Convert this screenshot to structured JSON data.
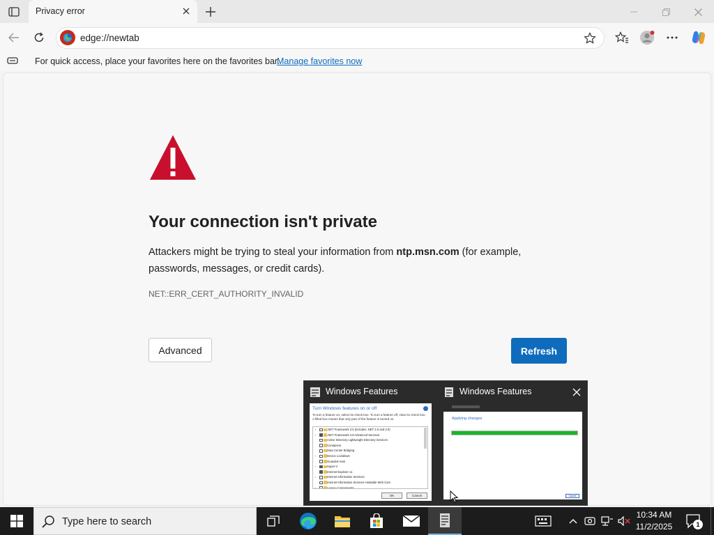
{
  "browser": {
    "tab": {
      "title": "Privacy error"
    },
    "address_bar": {
      "url": "edge://newtab"
    },
    "favorites_bar": {
      "message": "For quick access, place your favorites here on the favorites bar.",
      "link": "Manage favorites now"
    }
  },
  "error_page": {
    "title": "Your connection isn't private",
    "body_prefix": "Attackers might be trying to steal your information from ",
    "host": "ntp.msn.com",
    "body_suffix": " (for example, passwords, messages, or credit cards).",
    "error_code": "NET::ERR_CERT_AUTHORITY_INVALID",
    "advanced_label": "Advanced",
    "refresh_label": "Refresh"
  },
  "taskbar_preview": {
    "window1_title": "Windows Features",
    "window2_title": "Windows Features",
    "thumb1": {
      "heading": "Turn Windows features on or off",
      "description": "To turn a feature on, select its check box. To turn a feature off, clear its check box. A filled box means that only part of the feature is turned on.",
      "items": [
        {
          "label": ".NET Framework 3.5 (includes .NET 2.0 and 3.0)",
          "expandable": true,
          "checked": false
        },
        {
          "label": ".NET Framework 4.8 Advanced Services",
          "expandable": true,
          "checked": true
        },
        {
          "label": "Active Directory Lightweight Directory Services",
          "expandable": false,
          "checked": false
        },
        {
          "label": "Containers",
          "expandable": false,
          "checked": false
        },
        {
          "label": "Data Center Bridging",
          "expandable": false,
          "checked": false
        },
        {
          "label": "Device Lockdown",
          "expandable": true,
          "checked": false
        },
        {
          "label": "Guarded Host",
          "expandable": false,
          "checked": false
        },
        {
          "label": "Hyper-V",
          "expandable": true,
          "checked": true
        },
        {
          "label": "Internet Explorer 11",
          "expandable": false,
          "checked": true
        },
        {
          "label": "Internet Information Services",
          "expandable": true,
          "checked": false
        },
        {
          "label": "Internet Information Services Hostable Web Core",
          "expandable": false,
          "checked": false
        },
        {
          "label": "Legacy Components",
          "expandable": true,
          "checked": false
        }
      ],
      "ok_label": "OK",
      "cancel_label": "Cancel"
    },
    "thumb2": {
      "heading": "Applying changes",
      "progress": 1.0,
      "cancel_label": "Cancel"
    }
  },
  "taskbar": {
    "search_placeholder": "Type here to search",
    "clock_time": "10:34 AM",
    "clock_date": "11/2/2025",
    "notification_count": "1"
  },
  "colors": {
    "accent": "#0f6cbd",
    "warning": "#c8102e",
    "progress": "#17b52a"
  }
}
